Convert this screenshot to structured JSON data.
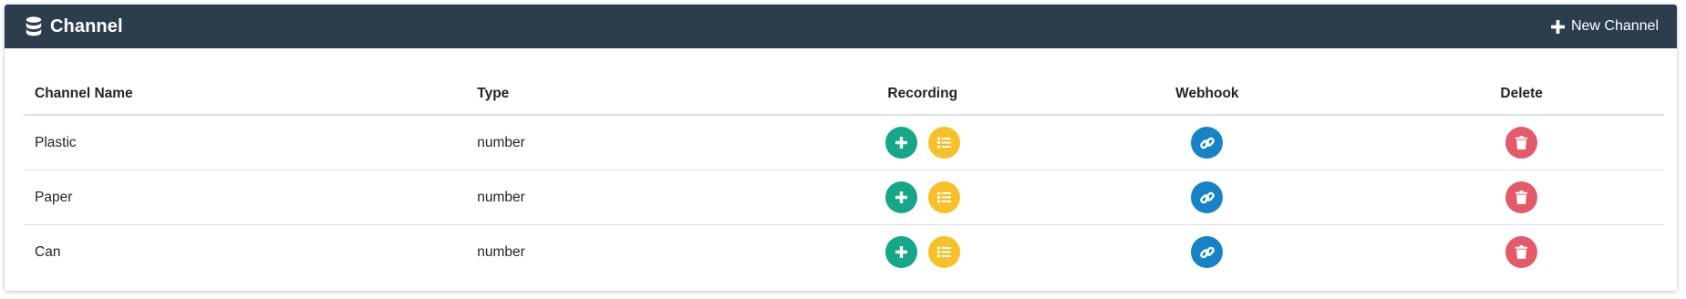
{
  "header": {
    "title": "Channel",
    "icon": "database-icon",
    "new_button_label": "New Channel",
    "background": "#2c3e4e"
  },
  "table": {
    "columns": [
      "Channel Name",
      "Type",
      "Recording",
      "Webhook",
      "Delete"
    ],
    "rows": [
      {
        "name": "Plastic",
        "type": "number"
      },
      {
        "name": "Paper",
        "type": "number"
      },
      {
        "name": "Can",
        "type": "number"
      }
    ]
  },
  "colors": {
    "add": "#16a68a",
    "list": "#f7c027",
    "webhook": "#1783c7",
    "delete": "#e35a6b"
  },
  "icons": {
    "add": "plus-icon",
    "list": "list-icon",
    "webhook": "link-icon",
    "delete": "trash-icon"
  }
}
